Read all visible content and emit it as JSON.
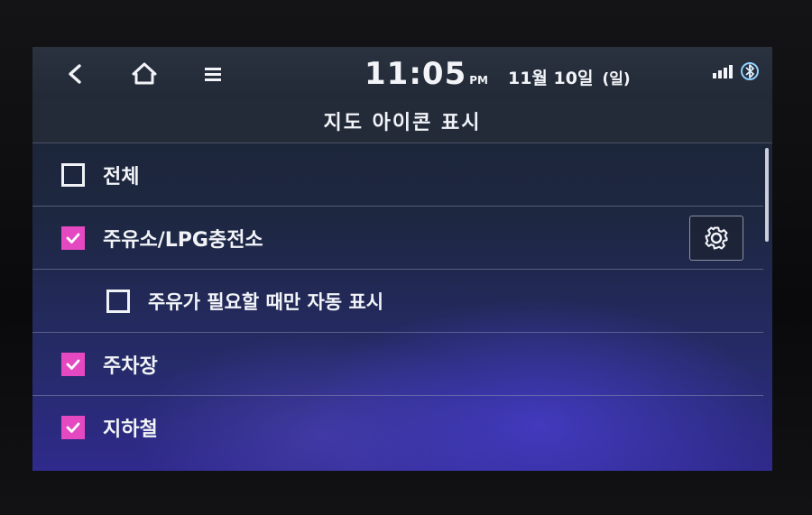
{
  "status_bar": {
    "time": "11:05",
    "ampm": "PM",
    "date": "11월 10일",
    "weekday": "(일)"
  },
  "page": {
    "title": "지도 아이콘 표시"
  },
  "list": {
    "items": [
      {
        "label": "전체",
        "checked": false
      },
      {
        "label": "주유소/LPG충전소",
        "checked": true
      },
      {
        "label": "주유가 필요할 때만 자동 표시",
        "checked": false
      },
      {
        "label": "주차장",
        "checked": true
      },
      {
        "label": "지하철",
        "checked": true
      }
    ]
  },
  "colors": {
    "checkbox_checked": "#e449c2",
    "text": "#f2f4f8",
    "title_bar": "#232b39"
  },
  "icons": {
    "back": "back-arrow-icon",
    "home": "home-icon",
    "menu": "menu-icon",
    "settings": "gear-icon",
    "signal": "signal-icon",
    "bluetooth": "bluetooth-audio-icon"
  }
}
